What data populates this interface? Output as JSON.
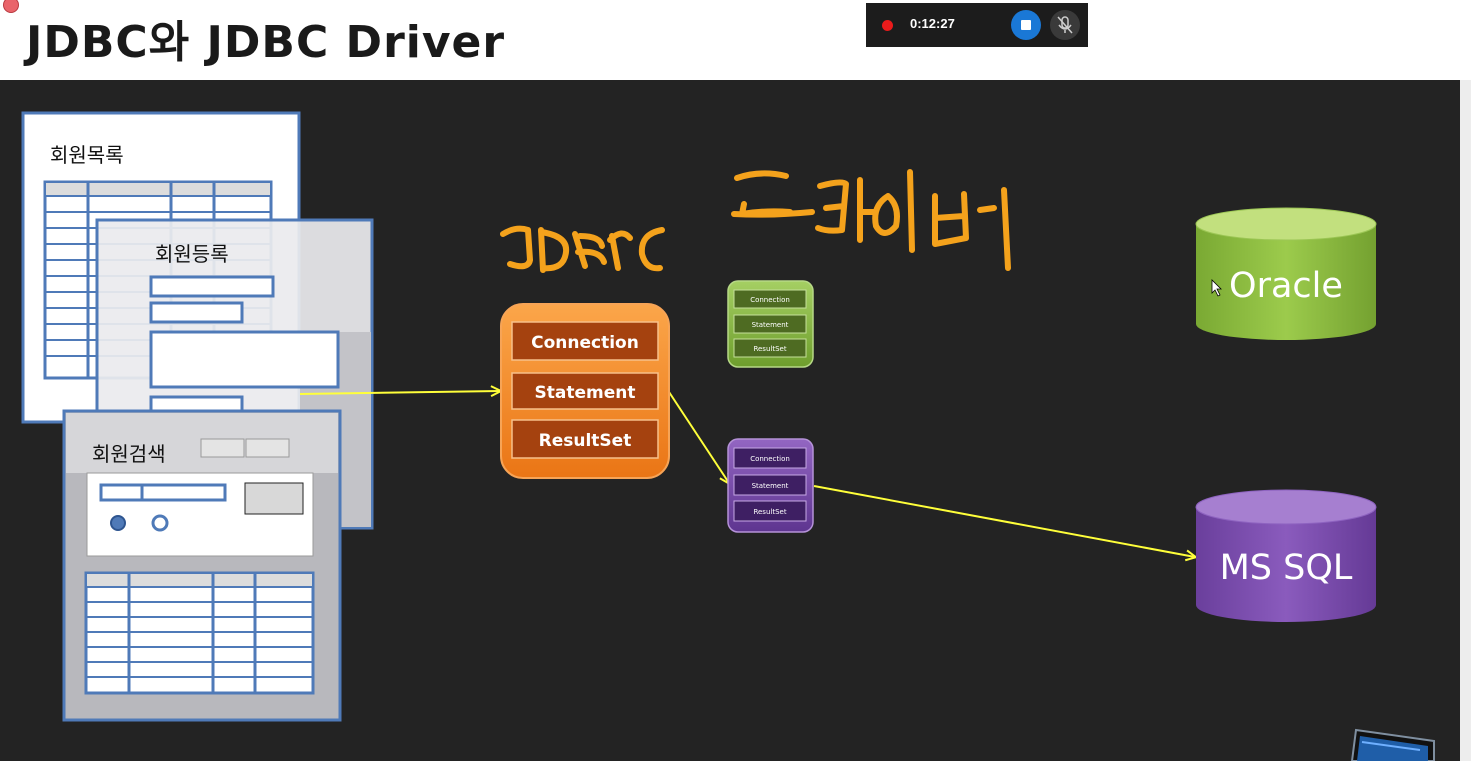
{
  "slide": {
    "title": "JDBC와 JDBC Driver",
    "window_list_title": "회원목록",
    "window_register_title": "회원등록",
    "window_search_title": "회원검색"
  },
  "recorder": {
    "time": "0:12:27",
    "stop_icon": "stop-icon",
    "mic_icon": "mic-muted-icon"
  },
  "jdbc_box": {
    "items": [
      "Connection",
      "Statement",
      "ResultSet"
    ],
    "color": "#f58a22"
  },
  "driver_green": {
    "items": [
      "Connection",
      "Statement",
      "ResultSet"
    ],
    "color": "#77a53a"
  },
  "driver_purple": {
    "items": [
      "Connection",
      "Statement",
      "ResultSet"
    ],
    "color": "#6a3f98"
  },
  "databases": {
    "oracle": {
      "label": "Oracle",
      "color": "#8cbd3c"
    },
    "mssql": {
      "label": "MS SQL",
      "color": "#7e4bb0"
    }
  },
  "colors": {
    "background": "#232323",
    "arrow": "#ffff3a",
    "annotation": "#f4a21c",
    "window_border": "#4f7ab8"
  }
}
